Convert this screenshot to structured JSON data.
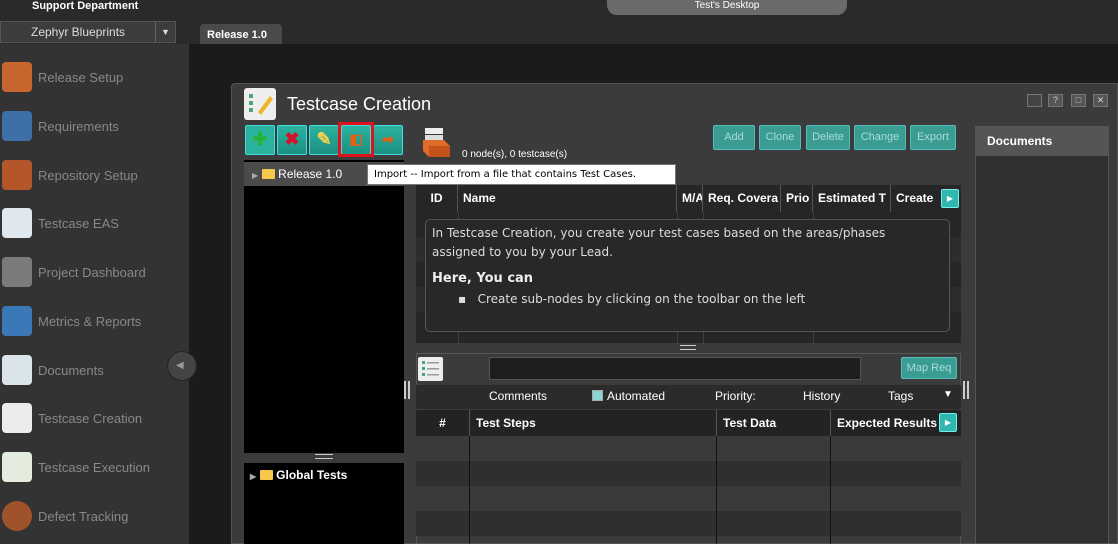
{
  "header": {
    "department": "Support Department",
    "desktop": "Test's Desktop",
    "project": "Zephyr Blueprints",
    "release_tab": "Release 1.0"
  },
  "sidebar": {
    "items": [
      {
        "label": "Release Setup",
        "icon": "release-setup-icon"
      },
      {
        "label": "Requirements",
        "icon": "requirements-icon"
      },
      {
        "label": "Repository Setup",
        "icon": "repository-setup-icon"
      },
      {
        "label": "Testcase EAS",
        "icon": "testcase-eas-icon"
      },
      {
        "label": "Project Dashboard",
        "icon": "project-dashboard-icon"
      },
      {
        "label": "Metrics & Reports",
        "icon": "metrics-reports-icon"
      },
      {
        "label": "Documents",
        "icon": "documents-icon"
      },
      {
        "label": "Testcase Creation",
        "icon": "testcase-creation-icon"
      },
      {
        "label": "Testcase Execution",
        "icon": "testcase-execution-icon"
      },
      {
        "label": "Defect Tracking",
        "icon": "defect-tracking-icon"
      }
    ]
  },
  "panel": {
    "title": "Testcase Creation",
    "window_buttons": [
      "?",
      "□",
      "✕"
    ],
    "node_count": "0 node(s), 0 testcase(s)",
    "actions": [
      "Add",
      "Clone",
      "Delete",
      "Change",
      "Export"
    ]
  },
  "tree": {
    "release": "Release 1.0",
    "global": "Global Tests"
  },
  "tooltip": "Import -- Import from a file that contains Test Cases.",
  "grid": {
    "columns": [
      "ID",
      "Name",
      "M/A",
      "Req. Covera",
      "Prio",
      "Estimated T",
      "Create"
    ]
  },
  "info": {
    "line1": "In Testcase Creation, you create your test cases based on the areas/phases",
    "line2": "assigned to you by your Lead.",
    "heading": "Here, You can",
    "bullet": "Create sub-nodes by clicking on the toolbar on the left"
  },
  "detail": {
    "map_req": "Map Req",
    "tabs": {
      "comments": "Comments",
      "automated": "Automated",
      "priority": "Priority:",
      "history": "History",
      "tags": "Tags"
    },
    "columns": [
      "#",
      "Test Steps",
      "Test Data",
      "Expected Results"
    ]
  },
  "documents": {
    "title": "Documents"
  },
  "colors": {
    "accent": "#2bb3a0",
    "highlight": "#e0121b"
  }
}
